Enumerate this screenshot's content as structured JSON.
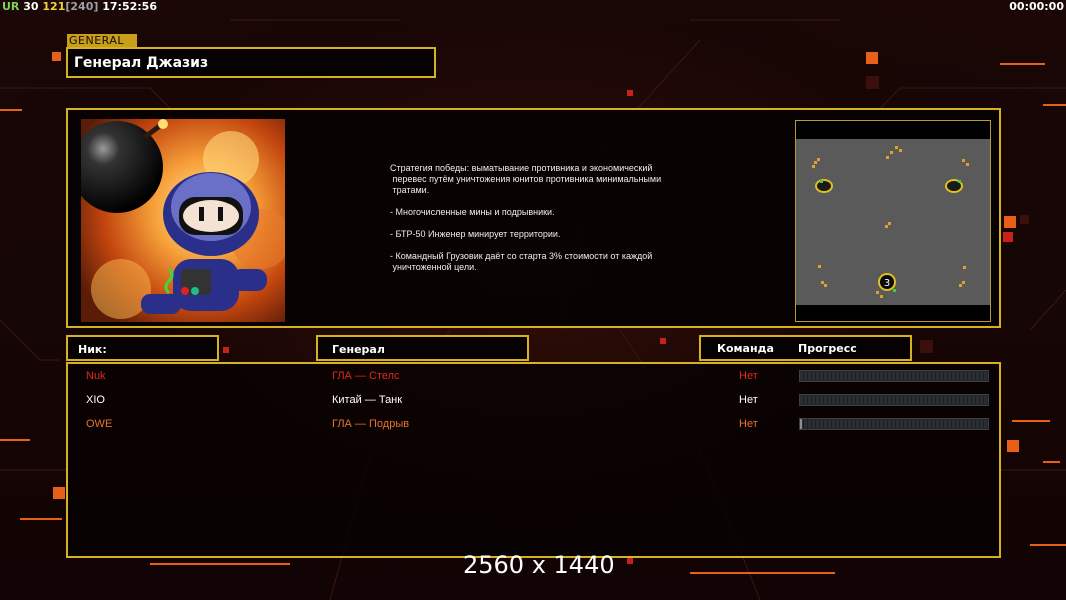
{
  "hud": {
    "ur_label": "UR",
    "v1": "30",
    "v2": "121",
    "v3": "[240]",
    "time": "17:52:56",
    "timer": "00:00:00"
  },
  "general": {
    "tag": "GENERAL",
    "name": "Генерал Джазиз",
    "description": "Стратегия победы: выматывание противника и экономический\n перевес путём уничтожения юнитов противника минимальными\n тратами.\n\n- Многочисленные мины и подрывники.\n\n- БТР-50 Инженер минирует территории.\n\n- Командный Грузовик даёт со старта 3% стоимости от каждой\n уничтоженной цели."
  },
  "minimap": {
    "marker_label": "3"
  },
  "headers": {
    "nick": "Ник:",
    "general": "Генерал",
    "team": "Команда",
    "progress": "Прогресс"
  },
  "players": [
    {
      "nick": "Nuk",
      "general": "ГЛА — Стелс",
      "team": "Нет",
      "color": "#e02a1a",
      "progress": 0
    },
    {
      "nick": "XIO",
      "general": "Китай — Танк",
      "team": "Нет",
      "color": "#ffffff",
      "progress": 0
    },
    {
      "nick": "OWE",
      "general": "ГЛА — Подрыв",
      "team": "Нет",
      "color": "#e8732a",
      "progress": 0.01
    }
  ],
  "resolution": "2560 x 1440",
  "colors": {
    "accent": "#d8b11e",
    "hud_green": "#7bd35a",
    "hud_yellow": "#f1d23a"
  }
}
